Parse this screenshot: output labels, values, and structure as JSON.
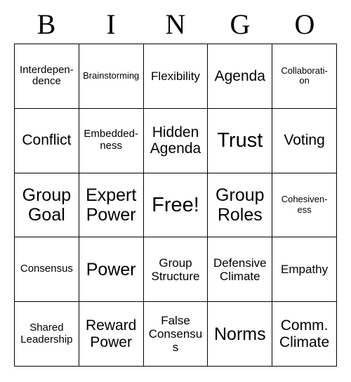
{
  "header": {
    "letters": [
      "B",
      "I",
      "N",
      "G",
      "O"
    ]
  },
  "grid": {
    "rows": [
      [
        {
          "text": "Interdepen-\ndence",
          "size": "fs-s"
        },
        {
          "text": "Brainstorming",
          "size": "fs-xs"
        },
        {
          "text": "Flexibility",
          "size": "fs-m"
        },
        {
          "text": "Agenda",
          "size": "fs-l"
        },
        {
          "text": "Collaborati-\non",
          "size": "fs-xs"
        }
      ],
      [
        {
          "text": "Conflict",
          "size": "fs-l"
        },
        {
          "text": "Embedded-\nness",
          "size": "fs-s"
        },
        {
          "text": "Hidden\nAgenda",
          "size": "fs-l"
        },
        {
          "text": "Trust",
          "size": "fs-xxl"
        },
        {
          "text": "Voting",
          "size": "fs-l"
        }
      ],
      [
        {
          "text": "Group\nGoal",
          "size": "fs-xl"
        },
        {
          "text": "Expert\nPower",
          "size": "fs-xl"
        },
        {
          "text": "Free!",
          "size": "fs-xxl"
        },
        {
          "text": "Group\nRoles",
          "size": "fs-xl"
        },
        {
          "text": "Cohesiven-\ness",
          "size": "fs-xs"
        }
      ],
      [
        {
          "text": "Consensus",
          "size": "fs-s"
        },
        {
          "text": "Power",
          "size": "fs-xl"
        },
        {
          "text": "Group\nStructure",
          "size": "fs-m"
        },
        {
          "text": "Defensive\nClimate",
          "size": "fs-m"
        },
        {
          "text": "Empathy",
          "size": "fs-m"
        }
      ],
      [
        {
          "text": "Shared\nLeadership",
          "size": "fs-s"
        },
        {
          "text": "Reward\nPower",
          "size": "fs-l"
        },
        {
          "text": "False\nConsensus",
          "size": "fs-m"
        },
        {
          "text": "Norms",
          "size": "fs-xl"
        },
        {
          "text": "Comm.\nClimate",
          "size": "fs-l"
        }
      ]
    ]
  }
}
